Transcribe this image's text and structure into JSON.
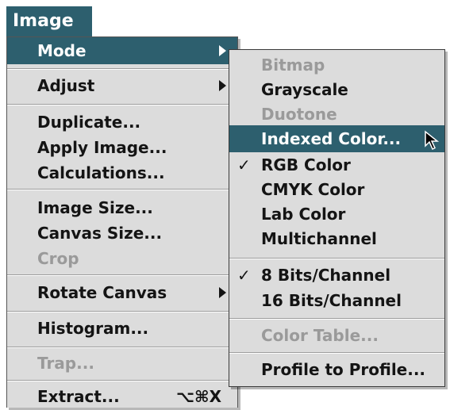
{
  "menubar": {
    "title": "Image"
  },
  "image_menu": {
    "items": [
      {
        "label": "Mode"
      },
      {
        "label": "Adjust"
      },
      {
        "label": "Duplicate..."
      },
      {
        "label": "Apply Image..."
      },
      {
        "label": "Calculations..."
      },
      {
        "label": "Image Size..."
      },
      {
        "label": "Canvas Size..."
      },
      {
        "label": "Crop"
      },
      {
        "label": "Rotate Canvas"
      },
      {
        "label": "Histogram..."
      },
      {
        "label": "Trap..."
      },
      {
        "label": "Extract...",
        "shortcut": "⌥⌘X"
      }
    ]
  },
  "mode_submenu": {
    "items": [
      {
        "label": "Bitmap"
      },
      {
        "label": "Grayscale"
      },
      {
        "label": "Duotone"
      },
      {
        "label": "Indexed Color..."
      },
      {
        "label": "RGB Color",
        "check": "✓"
      },
      {
        "label": "CMYK Color"
      },
      {
        "label": "Lab Color"
      },
      {
        "label": "Multichannel"
      },
      {
        "label": "8 Bits/Channel",
        "check": "✓"
      },
      {
        "label": "16 Bits/Channel"
      },
      {
        "label": "Color Table..."
      },
      {
        "label": "Profile to Profile..."
      }
    ]
  },
  "colors": {
    "highlight": "#2d5f6e",
    "menu_bg": "#dcdcdc",
    "disabled": "#9a9a9a"
  },
  "icons": {
    "submenu_arrow": "triangle-right",
    "cursor": "arrow-pointer"
  }
}
